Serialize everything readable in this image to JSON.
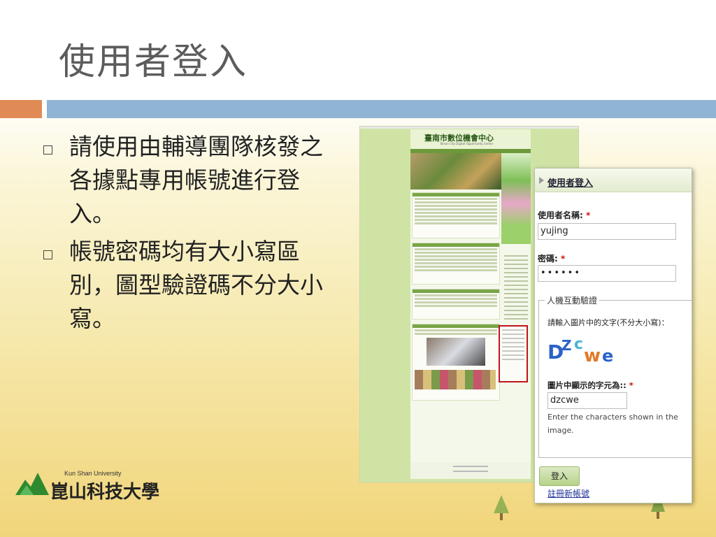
{
  "slide": {
    "title": "使用者登入",
    "bullets": [
      "請使用由輔導團隊核發之各據點專用帳號進行登入。",
      "帳號密碼均有大小寫區別，圖型驗證碼不分大小寫。"
    ],
    "logo": {
      "english": "Kun Shan University",
      "chinese": "崑山科技大學"
    }
  },
  "website": {
    "site_name": "臺南市數位機會中心",
    "site_subtitle": "Tainan City Digital Opportunity Center"
  },
  "login_panel": {
    "header": "使用者登入",
    "username_label": "使用者名稱:",
    "username_value": "yujing",
    "password_label": "密碼:",
    "password_value": "••••••",
    "required_mark": "*",
    "captcha_legend": "人機互動驗證",
    "captcha_hint": "請輸入圖片中的文字(不分大小寫)：",
    "captcha_image_text": "DZcwe",
    "captcha_field_label": "圖片中顯示的字元為::",
    "captcha_value": "dzcwe",
    "captcha_note": "Enter the characters shown in the image.",
    "login_button": "登入",
    "register_link": "註冊新帳號"
  },
  "colors": {
    "band_orange": "#e08b55",
    "band_blue": "#8fb4d4",
    "required": "#cc1111",
    "link": "#223399"
  }
}
